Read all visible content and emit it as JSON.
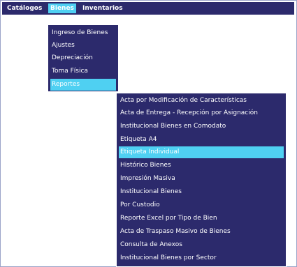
{
  "menubar": {
    "items": [
      {
        "label": "Catálogos"
      },
      {
        "label": "Bienes"
      },
      {
        "label": "Inventarios"
      }
    ]
  },
  "bienes_menu": {
    "items": [
      {
        "label": "Ingreso de Bienes"
      },
      {
        "label": "Ajustes"
      },
      {
        "label": "Depreciación"
      },
      {
        "label": "Toma Física"
      },
      {
        "label": "Reportes"
      }
    ]
  },
  "reportes_menu": {
    "items": [
      {
        "label": "Acta por Modificación de Características"
      },
      {
        "label": "Acta de Entrega - Recepción por Asignación"
      },
      {
        "label": "Institucional Bienes en Comodato"
      },
      {
        "label": "Etiqueta A4"
      },
      {
        "label": "Etiqueta Individual"
      },
      {
        "label": "Histórico Bienes"
      },
      {
        "label": "Impresión Masiva"
      },
      {
        "label": "Institucional Bienes"
      },
      {
        "label": "Por Custodio"
      },
      {
        "label": "Reporte Excel por Tipo de Bien"
      },
      {
        "label": "Acta de Traspaso Masivo de Bienes"
      },
      {
        "label": "Consulta de Anexos"
      },
      {
        "label": "Institucional Bienes por Sector"
      }
    ]
  },
  "colors": {
    "menu_background": "#2c2a6c",
    "highlight": "#4fd0f2",
    "text": "#ffffff"
  }
}
